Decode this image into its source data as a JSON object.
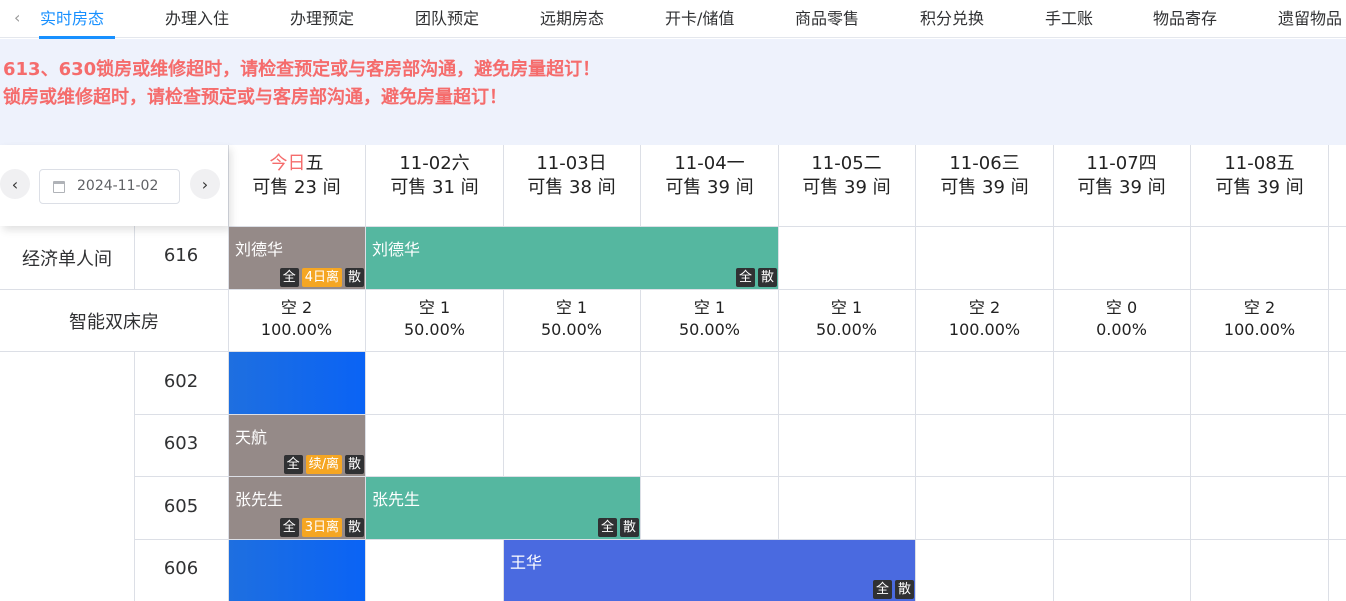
{
  "tabs": {
    "back_icon": "chevron-left-icon",
    "items": [
      {
        "label": "实时房态",
        "active": true
      },
      {
        "label": "办理入住"
      },
      {
        "label": "办理预定"
      },
      {
        "label": "团队预定"
      },
      {
        "label": "远期房态"
      },
      {
        "label": "开卡/储值"
      },
      {
        "label": "商品零售"
      },
      {
        "label": "积分兑换"
      },
      {
        "label": "手工账"
      },
      {
        "label": "物品寄存"
      },
      {
        "label": "遗留物品"
      }
    ]
  },
  "notice": {
    "lines": [
      "613、630锁房或维修超时，请检查预定或与客房部沟通，避免房量超订！",
      "锁房或维修超时，请检查预定或与客房部沟通，避免房量超订！"
    ],
    "color": "#f56c6c"
  },
  "datebar": {
    "prev_icon": "chevron-left-icon",
    "next_icon": "chevron-right-icon",
    "calendar_icon": "calendar-icon",
    "date": "2024-11-02"
  },
  "columns": [
    {
      "today": "今日",
      "weekday": "五",
      "avail": "可售 23 间"
    },
    {
      "date": "11-02",
      "weekday": "六",
      "avail": "可售 31 间"
    },
    {
      "date": "11-03",
      "weekday": "日",
      "avail": "可售 38 间"
    },
    {
      "date": "11-04",
      "weekday": "一",
      "avail": "可售 39 间"
    },
    {
      "date": "11-05",
      "weekday": "二",
      "avail": "可售 39 间"
    },
    {
      "date": "11-06",
      "weekday": "三",
      "avail": "可售 39 间"
    },
    {
      "date": "11-07",
      "weekday": "四",
      "avail": "可售 39 间"
    },
    {
      "date": "11-08",
      "weekday": "五",
      "avail": "可售 39 间"
    }
  ],
  "room_types": {
    "economy_single": {
      "name": "经济单人间",
      "room": "616"
    },
    "smart_twin": {
      "name": "智能双床房",
      "stats": [
        {
          "empty": "空 2",
          "rate": "100.00%"
        },
        {
          "empty": "空 1",
          "rate": "50.00%"
        },
        {
          "empty": "空 1",
          "rate": "50.00%"
        },
        {
          "empty": "空 1",
          "rate": "50.00%"
        },
        {
          "empty": "空 1",
          "rate": "50.00%"
        },
        {
          "empty": "空 2",
          "rate": "100.00%"
        },
        {
          "empty": "空 0",
          "rate": "0.00%"
        },
        {
          "empty": "空 2",
          "rate": "100.00%"
        }
      ],
      "rooms": [
        "602",
        "603",
        "605",
        "606"
      ]
    }
  },
  "bookings": {
    "b616a": {
      "guest": "刘德华",
      "badges": [
        "全",
        "4日离",
        "散"
      ]
    },
    "b616b": {
      "guest": "刘德华",
      "badges": [
        "全",
        "散"
      ]
    },
    "b603": {
      "guest": "天航",
      "badges": [
        "全",
        "续/离",
        "散"
      ]
    },
    "b605a": {
      "guest": "张先生",
      "badges": [
        "全",
        "3日离",
        "散"
      ]
    },
    "b605b": {
      "guest": "张先生",
      "badges": [
        "全",
        "散"
      ]
    },
    "b606": {
      "guest": "王华",
      "badges": [
        "全",
        "散"
      ]
    }
  },
  "colors": {
    "accent": "#1890ff",
    "in_house": "#958a88",
    "reserved_green": "#55b7a0",
    "reserved_blue": "#4a6ae0",
    "blocked": "#0a63f5",
    "badge_orange": "#f5a623"
  }
}
